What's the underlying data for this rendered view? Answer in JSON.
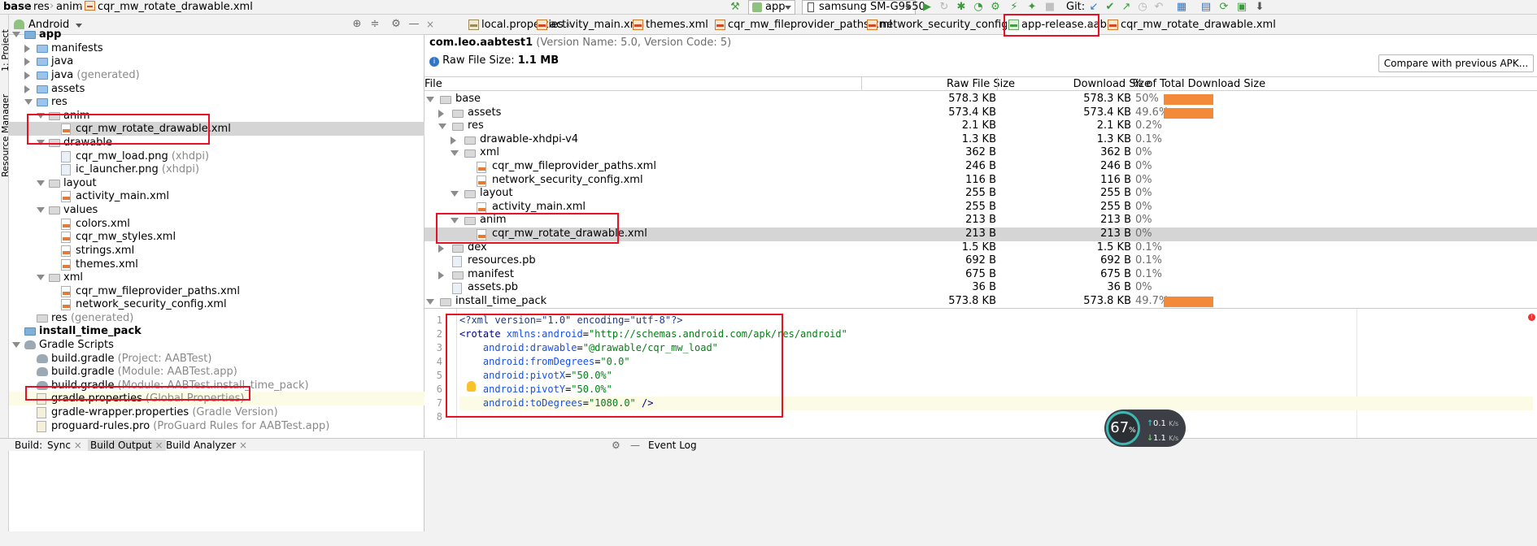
{
  "breadcrumb": [
    "base",
    "res",
    "anim",
    "cqr_mw_rotate_drawable.xml"
  ],
  "toolbar": {
    "config": "app",
    "device": "samsung SM-G9550",
    "git_label": "Git:"
  },
  "left_strip": {
    "project_tab": "1: Project",
    "resource_tab": "Resource Manager"
  },
  "project_panel": {
    "view_mode": "Android",
    "tree": [
      {
        "name": "app",
        "secondary": ""
      },
      {
        "name": "manifests",
        "secondary": ""
      },
      {
        "name": "java",
        "secondary": ""
      },
      {
        "name": "java",
        "secondary": "(generated)"
      },
      {
        "name": "assets",
        "secondary": ""
      },
      {
        "name": "res",
        "secondary": ""
      },
      {
        "name": "anim",
        "secondary": ""
      },
      {
        "name": "cqr_mw_rotate_drawable.xml",
        "secondary": ""
      },
      {
        "name": "drawable",
        "secondary": ""
      },
      {
        "name": "cqr_mw_load.png",
        "secondary": "(xhdpi)"
      },
      {
        "name": "ic_launcher.png",
        "secondary": "(xhdpi)"
      },
      {
        "name": "layout",
        "secondary": ""
      },
      {
        "name": "activity_main.xml",
        "secondary": ""
      },
      {
        "name": "values",
        "secondary": ""
      },
      {
        "name": "colors.xml",
        "secondary": ""
      },
      {
        "name": "cqr_mw_styles.xml",
        "secondary": ""
      },
      {
        "name": "strings.xml",
        "secondary": ""
      },
      {
        "name": "themes.xml",
        "secondary": ""
      },
      {
        "name": "xml",
        "secondary": ""
      },
      {
        "name": "cqr_mw_fileprovider_paths.xml",
        "secondary": ""
      },
      {
        "name": "network_security_config.xml",
        "secondary": ""
      },
      {
        "name": "res",
        "secondary": "(generated)"
      },
      {
        "name": "install_time_pack",
        "secondary": ""
      },
      {
        "name": "Gradle Scripts",
        "secondary": ""
      },
      {
        "name": "build.gradle",
        "secondary": "(Project: AABTest)"
      },
      {
        "name": "build.gradle",
        "secondary": "(Module: AABTest.app)"
      },
      {
        "name": "build.gradle",
        "secondary": "(Module: AABTest.install_time_pack)"
      },
      {
        "name": "gradle.properties",
        "secondary": "(Global Properties)"
      },
      {
        "name": "gradle-wrapper.properties",
        "secondary": "(Gradle Version)"
      },
      {
        "name": "proguard-rules.pro",
        "secondary": "(ProGuard Rules for AABTest.app)"
      }
    ]
  },
  "editor_tabs": [
    {
      "label": "local.properties"
    },
    {
      "label": "activity_main.xml"
    },
    {
      "label": "themes.xml"
    },
    {
      "label": "cqr_mw_fileprovider_paths.xml"
    },
    {
      "label": "network_security_config.xml"
    },
    {
      "label": "app-release.aab"
    },
    {
      "label": "cqr_mw_rotate_drawable.xml"
    }
  ],
  "analyzer": {
    "package": "com.leo.aabtest1",
    "version_info": "(Version Name: 5.0, Version Code: 5)",
    "raw_size_label": "Raw File Size:",
    "raw_size_value": "1.1 MB",
    "compare_button": "Compare with previous APK...",
    "columns": [
      "File",
      "Raw File Size",
      "Download Size",
      "% of Total Download Size"
    ],
    "rows": [
      {
        "name": "base",
        "raw": "578.3 KB",
        "download": "578.3 KB",
        "pct": "50%",
        "share": 50
      },
      {
        "name": "assets",
        "raw": "573.4 KB",
        "download": "573.4 KB",
        "pct": "49.6%",
        "share": 49.6
      },
      {
        "name": "res",
        "raw": "2.1 KB",
        "download": "2.1 KB",
        "pct": "0.2%",
        "share": 0.2
      },
      {
        "name": "drawable-xhdpi-v4",
        "raw": "1.3 KB",
        "download": "1.3 KB",
        "pct": "0.1%",
        "share": 0.1
      },
      {
        "name": "xml",
        "raw": "362 B",
        "download": "362 B",
        "pct": "0%",
        "share": 0
      },
      {
        "name": "cqr_mw_fileprovider_paths.xml",
        "raw": "246 B",
        "download": "246 B",
        "pct": "0%",
        "share": 0
      },
      {
        "name": "network_security_config.xml",
        "raw": "116 B",
        "download": "116 B",
        "pct": "0%",
        "share": 0
      },
      {
        "name": "layout",
        "raw": "255 B",
        "download": "255 B",
        "pct": "0%",
        "share": 0
      },
      {
        "name": "activity_main.xml",
        "raw": "255 B",
        "download": "255 B",
        "pct": "0%",
        "share": 0
      },
      {
        "name": "anim",
        "raw": "213 B",
        "download": "213 B",
        "pct": "0%",
        "share": 0
      },
      {
        "name": "cqr_mw_rotate_drawable.xml",
        "raw": "213 B",
        "download": "213 B",
        "pct": "0%",
        "share": 0
      },
      {
        "name": "dex",
        "raw": "1.5 KB",
        "download": "1.5 KB",
        "pct": "0.1%",
        "share": 0.1
      },
      {
        "name": "resources.pb",
        "raw": "692 B",
        "download": "692 B",
        "pct": "0.1%",
        "share": 0.1
      },
      {
        "name": "manifest",
        "raw": "675 B",
        "download": "675 B",
        "pct": "0.1%",
        "share": 0.1
      },
      {
        "name": "assets.pb",
        "raw": "36 B",
        "download": "36 B",
        "pct": "0%",
        "share": 0
      },
      {
        "name": "install_time_pack",
        "raw": "573.8 KB",
        "download": "573.8 KB",
        "pct": "49.7%",
        "share": 49.7
      }
    ]
  },
  "code": {
    "line_numbers": [
      "1",
      "2",
      "3",
      "4",
      "5",
      "6",
      "7",
      "8"
    ],
    "lines": [
      [
        "<?xml version=\"1.0\" encoding=\"utf-8\"?>"
      ],
      [
        "<rotate ",
        "xmlns:android",
        "=",
        "\"http://schemas.android.com/apk/res/android\""
      ],
      [
        "    ",
        "android:drawable",
        "=",
        "\"@drawable/cqr_mw_load\""
      ],
      [
        "    ",
        "android:fromDegrees",
        "=",
        "\"0.0\""
      ],
      [
        "    ",
        "android:pivotX",
        "=",
        "\"50.0%\""
      ],
      [
        "    ",
        "android:pivotY",
        "=",
        "\"50.0%\""
      ],
      [
        "    ",
        "android:toDegrees",
        "=",
        "\"1080.0\"",
        " />"
      ],
      [
        ""
      ]
    ]
  },
  "bottom_bar": {
    "build": "Build:",
    "sync": "Sync",
    "build_output": "Build Output",
    "build_analyzer": "Build Analyzer",
    "event_log": "Event Log"
  },
  "net_widget": {
    "percent": "67",
    "percent_sign": "%",
    "up": "0.1",
    "down": "1.1",
    "unit": "K/s"
  },
  "colors": {
    "bar": "#f28a3a",
    "highlight": "#e81123",
    "selection": "#d5d5d5"
  }
}
